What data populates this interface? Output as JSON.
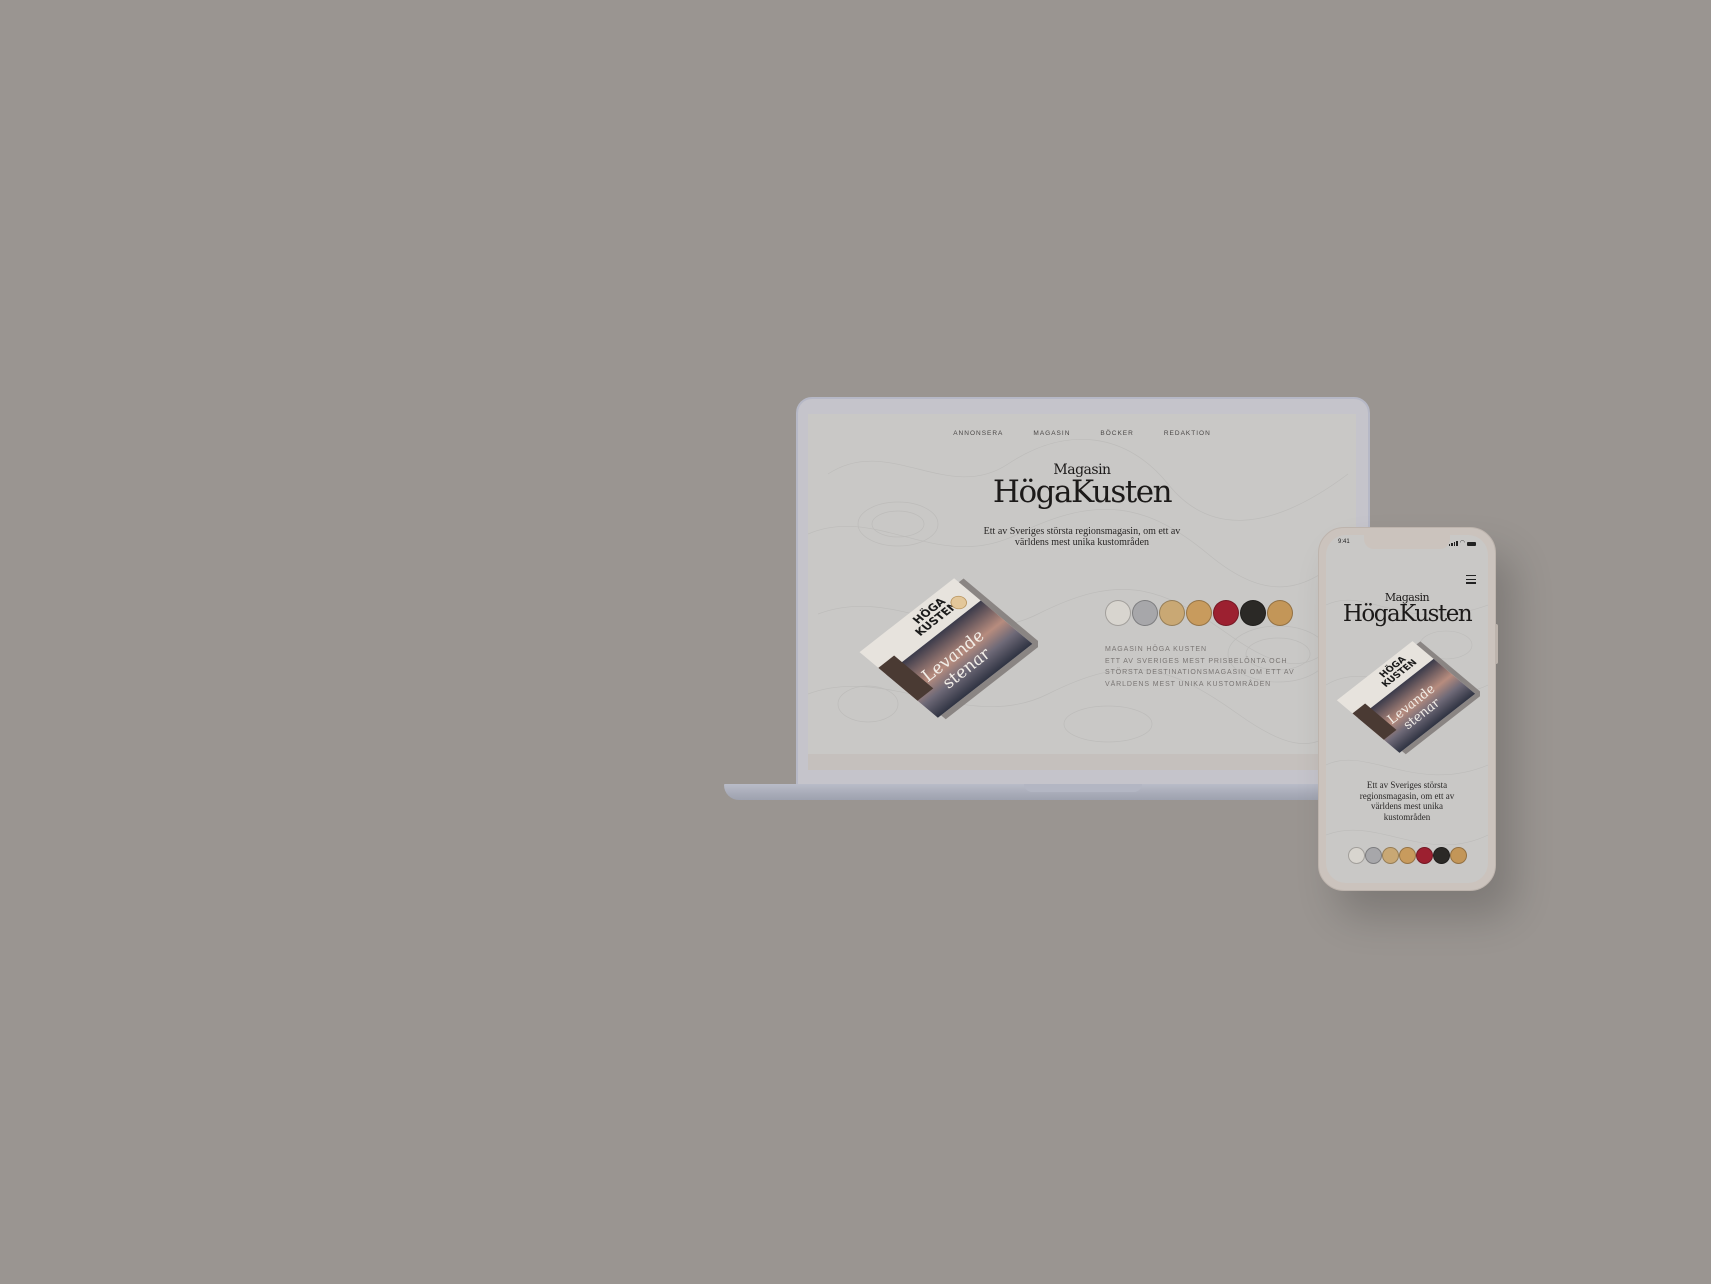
{
  "laptop": {
    "nav": [
      "ANNONSERA",
      "MAGASIN",
      "BÖCKER",
      "REDAKTION"
    ],
    "logo_small": "Magasin",
    "logo_big": "HögaKusten",
    "tagline_line1": "Ett av Sveriges största regionsmagasin, om ett av",
    "tagline_line2": "världens mest unika kustområden",
    "magazine_title_line1": "HÖGA",
    "magazine_title_line2": "KUSTEN",
    "magazine_script_line1": "Levande",
    "magazine_script_line2": "stenar",
    "description": [
      "MAGASIN HÖGA KUSTEN",
      "ETT AV SVERIGES MEST PRISBELÖNTA OCH",
      "STÖRSTA DESTINATIONSMAGASIN OM ETT AV",
      "VÄRLDENS MEST UNIKA KUSTOMRÅDEN"
    ]
  },
  "phone": {
    "time": "9:41",
    "logo_small": "Magasin",
    "logo_big": "HögaKusten",
    "tagline_lines": [
      "Ett av Sveriges största",
      "regionsmagasin, om ett av",
      "världens mest unika",
      "kustområden"
    ]
  },
  "badges": [
    {
      "color": "#d8d5cf"
    },
    {
      "color": "#a7a7aa"
    },
    {
      "color": "#c9a874"
    },
    {
      "color": "#c89b5d"
    },
    {
      "color": "#9c2030"
    },
    {
      "color": "#2b2926"
    },
    {
      "color": "#c39658"
    }
  ]
}
